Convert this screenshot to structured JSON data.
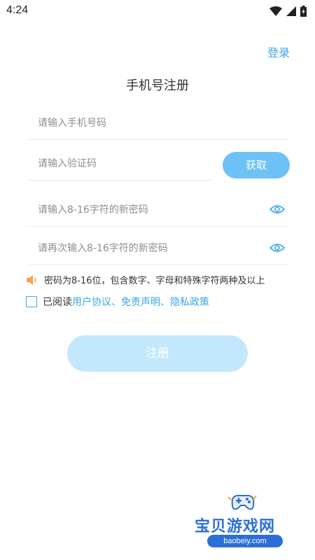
{
  "status_bar": {
    "time": "4:24"
  },
  "header": {
    "login_link": "登录",
    "title": "手机号注册"
  },
  "form": {
    "phone_placeholder": "请输入手机号码",
    "code_placeholder": "请输入验证码",
    "get_code_button": "获取",
    "password_placeholder": "请输入8-16字符的新密码",
    "confirm_password_placeholder": "请再次输入8-16字符的新密码",
    "password_hint": "密码为8-16位，包含数字、字母和特殊字符两种及以上",
    "agreement_prefix": "已阅读",
    "agreement_link_user": "用户协议",
    "agreement_sep1": "、",
    "agreement_link_disclaimer": "免责声明",
    "agreement_sep2": "、",
    "agreement_link_privacy": "隐私政策",
    "agreement_checked": false,
    "register_button": "注册"
  },
  "watermark": {
    "title": "宝贝游戏网",
    "url": "baobeiy.com"
  },
  "colors": {
    "accent": "#3ea6e8",
    "button": "#6cc2f5",
    "register_disabled": "#c3e8fd",
    "hint_icon": "#f5a04a"
  },
  "icons": [
    "wifi-icon",
    "signal-icon",
    "battery-icon",
    "eye-icon",
    "speaker-icon",
    "gamepad-icon"
  ]
}
